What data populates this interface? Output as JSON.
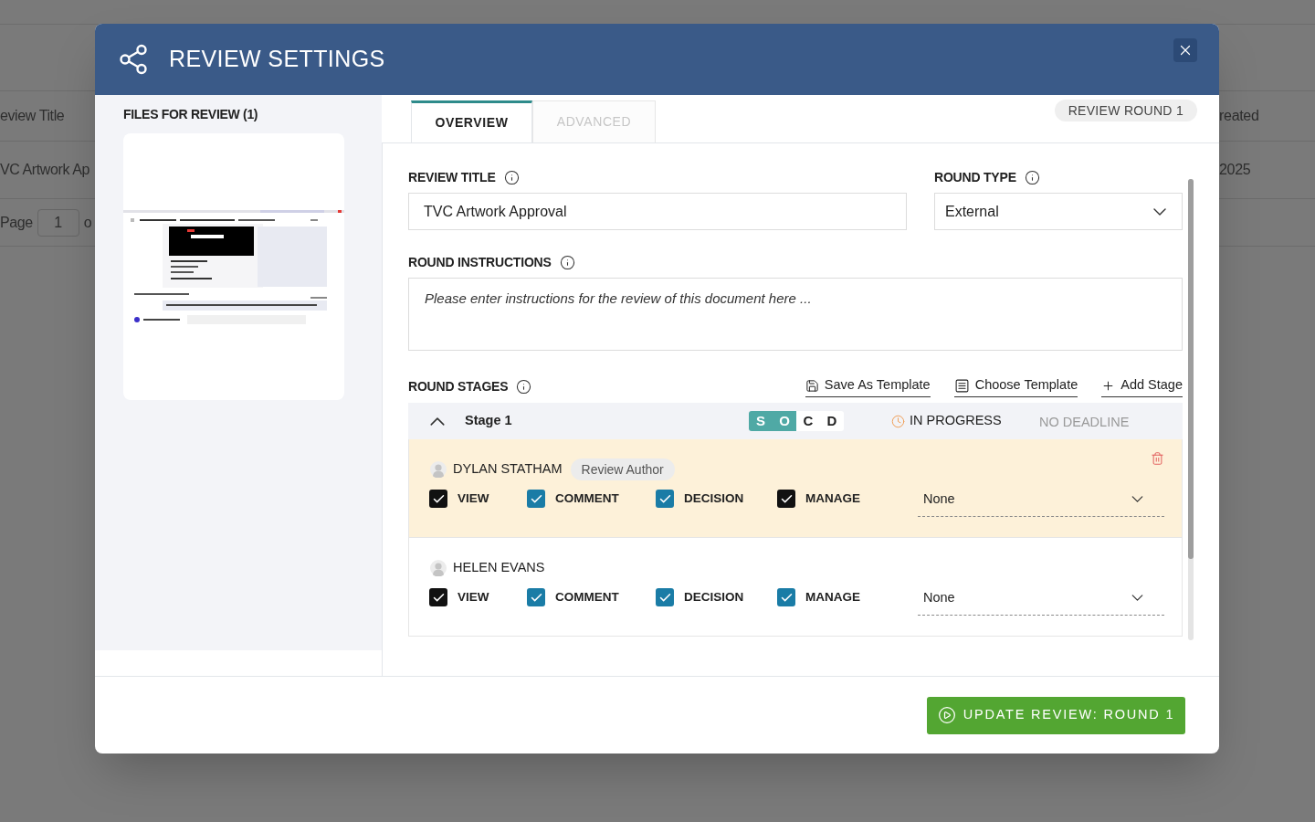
{
  "background_table": {
    "rows": [
      [
        "eview Title",
        "reated"
      ],
      [
        "VC Artwork Ap",
        "2025"
      ]
    ],
    "pager": {
      "label": "Page",
      "page": "1",
      "of": "o"
    }
  },
  "dialog": {
    "title": "REVIEW SETTINGS",
    "files": {
      "heading": "FILES FOR REVIEW (1)"
    },
    "tabs": [
      {
        "label": "OVERVIEW",
        "selected": true
      },
      {
        "label": "ADVANCED",
        "selected": false
      }
    ],
    "round_badge": "REVIEW ROUND 1",
    "review_title": {
      "label": "REVIEW TITLE",
      "value": "TVC Artwork Approval"
    },
    "round_type": {
      "label": "ROUND TYPE",
      "value": "External"
    },
    "round_instructions": {
      "label": "ROUND INSTRUCTIONS",
      "placeholder": "Please enter instructions for the review of this document here ..."
    },
    "round_stages": {
      "label": "ROUND STAGES",
      "actions": [
        {
          "kind": "save",
          "label": "Save As Template"
        },
        {
          "kind": "choose",
          "label": "Choose Template"
        },
        {
          "kind": "add",
          "label": "Add Stage"
        }
      ],
      "stages": [
        {
          "name": "Stage 1",
          "expanded": true,
          "steps": [
            {
              "letter": "S",
              "selected": true
            },
            {
              "letter": "O",
              "selected": true
            },
            {
              "letter": "C",
              "selected": false
            },
            {
              "letter": "D",
              "selected": false
            }
          ],
          "status": "IN PROGRESS",
          "deadline": "NO DEADLINE",
          "members": [
            {
              "name": "DYLAN STATHAM",
              "role": "Review Author",
              "highlighted": true,
              "permissions": [
                {
                  "label": "VIEW",
                  "checked": true,
                  "color": "#111111"
                },
                {
                  "label": "COMMENT",
                  "checked": true,
                  "color": "#1a7ca6"
                },
                {
                  "label": "DECISION",
                  "checked": true,
                  "color": "#1a7ca6"
                },
                {
                  "label": "MANAGE",
                  "checked": true,
                  "color": "#111111"
                }
              ],
              "notification": "None"
            },
            {
              "name": "HELEN EVANS",
              "highlighted": false,
              "permissions": [
                {
                  "label": "VIEW",
                  "checked": true,
                  "color": "#111111"
                },
                {
                  "label": "COMMENT",
                  "checked": true,
                  "color": "#1a7ca6"
                },
                {
                  "label": "DECISION",
                  "checked": true,
                  "color": "#1a7ca6"
                },
                {
                  "label": "MANAGE",
                  "checked": true,
                  "color": "#1a7ca6"
                }
              ],
              "notification": "None"
            }
          ]
        }
      ]
    },
    "submit_button": "UPDATE REVIEW: ROUND 1"
  }
}
